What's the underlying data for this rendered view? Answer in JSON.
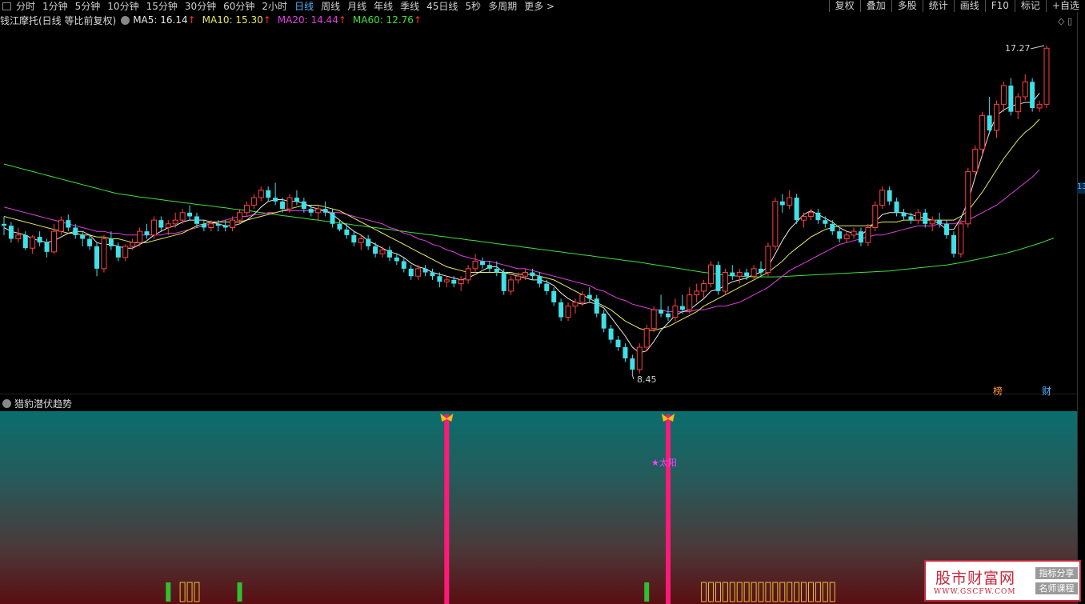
{
  "toolbar": {
    "items": [
      "分时",
      "1分钟",
      "5分钟",
      "10分钟",
      "15分钟",
      "30分钟",
      "60分钟",
      "2小时",
      "日线",
      "周线",
      "月线",
      "年线",
      "季线",
      "45日线",
      "5秒",
      "多周期",
      "更多 >"
    ],
    "active_index": 8,
    "right": [
      "复权",
      "叠加",
      "多股",
      "统计",
      "画线",
      "F10",
      "标记",
      "+自选"
    ]
  },
  "main_header": {
    "title": "钱江摩托(日线 等比前复权)",
    "ma": [
      {
        "label": "MA5: 16.14",
        "color": "#e8e8e8"
      },
      {
        "label": "MA10: 15.30",
        "color": "#e8e860"
      },
      {
        "label": "MA20: 14.44",
        "color": "#e040e0"
      },
      {
        "label": "MA60: 12.76",
        "color": "#40e040"
      }
    ],
    "arrow": "↑"
  },
  "annotations": {
    "high": "17.27",
    "low": "8.45",
    "badge1": "榜",
    "badge2": "财",
    "price_tag": "13"
  },
  "sub_header": {
    "title": "猎豹潜伏趋势"
  },
  "sub": {
    "label_sun": "★太阳"
  },
  "watermark": {
    "big": "股市财富网",
    "url": "WWW.GSCFW.COM",
    "tag1": "指标分享",
    "tag2": "名师课程"
  },
  "colors": {
    "up": "#ff4040",
    "down": "#40e0e8",
    "ma5": "#e8e8e8",
    "ma10": "#e8e860",
    "ma20": "#e040e0",
    "ma60": "#40e040",
    "signal": "#ff1a7a"
  },
  "chart_data": {
    "type": "candlestick",
    "price_range": [
      8.45,
      17.27
    ],
    "candles": [
      [
        12.5,
        12.7,
        12.2,
        12.45
      ],
      [
        12.45,
        12.55,
        12.0,
        12.1
      ],
      [
        12.1,
        12.4,
        12.0,
        12.2
      ],
      [
        12.2,
        12.3,
        11.8,
        11.85
      ],
      [
        11.85,
        12.2,
        11.7,
        12.15
      ],
      [
        12.15,
        12.3,
        11.9,
        12.0
      ],
      [
        12.0,
        12.1,
        11.6,
        11.75
      ],
      [
        11.75,
        12.5,
        11.7,
        12.3
      ],
      [
        12.3,
        12.7,
        12.2,
        12.6
      ],
      [
        12.6,
        12.75,
        12.3,
        12.4
      ],
      [
        12.4,
        12.5,
        12.1,
        12.2
      ],
      [
        12.2,
        12.3,
        11.9,
        12.1
      ],
      [
        12.1,
        12.2,
        11.8,
        11.9
      ],
      [
        11.9,
        12.0,
        11.1,
        11.3
      ],
      [
        11.3,
        12.2,
        11.2,
        12.1
      ],
      [
        12.1,
        12.3,
        11.8,
        11.9
      ],
      [
        11.9,
        12.0,
        11.5,
        11.6
      ],
      [
        11.6,
        11.95,
        11.5,
        11.9
      ],
      [
        11.9,
        12.1,
        11.8,
        12.0
      ],
      [
        12.0,
        12.4,
        11.9,
        12.3
      ],
      [
        12.3,
        12.5,
        12.1,
        12.2
      ],
      [
        12.2,
        12.7,
        12.1,
        12.6
      ],
      [
        12.6,
        12.7,
        12.3,
        12.4
      ],
      [
        12.4,
        12.6,
        12.2,
        12.5
      ],
      [
        12.5,
        12.8,
        12.4,
        12.6
      ],
      [
        12.6,
        12.9,
        12.5,
        12.8
      ],
      [
        12.8,
        13.0,
        12.6,
        12.7
      ],
      [
        12.7,
        12.8,
        12.4,
        12.5
      ],
      [
        12.5,
        12.6,
        12.3,
        12.4
      ],
      [
        12.4,
        12.6,
        12.3,
        12.5
      ],
      [
        12.5,
        12.6,
        12.3,
        12.45
      ],
      [
        12.45,
        12.6,
        12.3,
        12.4
      ],
      [
        12.4,
        12.7,
        12.3,
        12.6
      ],
      [
        12.6,
        12.9,
        12.5,
        12.8
      ],
      [
        12.8,
        13.1,
        12.7,
        13.0
      ],
      [
        13.0,
        13.3,
        12.9,
        13.2
      ],
      [
        13.2,
        13.5,
        13.1,
        13.4
      ],
      [
        13.4,
        13.5,
        13.1,
        13.2
      ],
      [
        13.2,
        13.6,
        13.0,
        13.1
      ],
      [
        13.1,
        13.2,
        12.8,
        12.9
      ],
      [
        12.9,
        13.3,
        12.8,
        13.2
      ],
      [
        13.2,
        13.4,
        13.0,
        13.1
      ],
      [
        13.1,
        13.2,
        12.8,
        12.9
      ],
      [
        12.9,
        13.0,
        12.7,
        12.8
      ],
      [
        12.8,
        13.0,
        12.6,
        12.9
      ],
      [
        12.9,
        13.1,
        12.7,
        12.8
      ],
      [
        12.8,
        12.9,
        12.4,
        12.5
      ],
      [
        12.5,
        12.6,
        12.3,
        12.35
      ],
      [
        12.35,
        12.5,
        12.1,
        12.2
      ],
      [
        12.2,
        12.3,
        11.9,
        12.0
      ],
      [
        12.0,
        12.2,
        11.8,
        12.1
      ],
      [
        12.1,
        12.2,
        11.8,
        11.9
      ],
      [
        11.9,
        12.0,
        11.6,
        11.7
      ],
      [
        11.7,
        11.9,
        11.6,
        11.8
      ],
      [
        11.8,
        11.9,
        11.5,
        11.6
      ],
      [
        11.6,
        11.7,
        11.4,
        11.5
      ],
      [
        11.5,
        11.6,
        11.2,
        11.3
      ],
      [
        11.3,
        11.4,
        11.0,
        11.1
      ],
      [
        11.1,
        11.4,
        11.0,
        11.3
      ],
      [
        11.3,
        11.4,
        11.1,
        11.2
      ],
      [
        11.2,
        11.3,
        11.0,
        11.1
      ],
      [
        11.1,
        11.2,
        10.8,
        10.95
      ],
      [
        10.95,
        11.1,
        10.8,
        11.0
      ],
      [
        11.0,
        11.1,
        10.8,
        10.9
      ],
      [
        10.9,
        11.1,
        10.7,
        11.0
      ],
      [
        11.0,
        11.4,
        10.9,
        11.3
      ],
      [
        11.3,
        11.7,
        11.2,
        11.5
      ],
      [
        11.5,
        11.6,
        11.3,
        11.4
      ],
      [
        11.4,
        11.5,
        11.2,
        11.3
      ],
      [
        11.3,
        11.5,
        11.1,
        11.2
      ],
      [
        11.2,
        11.3,
        10.6,
        10.7
      ],
      [
        10.7,
        11.1,
        10.6,
        11.0
      ],
      [
        11.0,
        11.2,
        10.9,
        11.1
      ],
      [
        11.1,
        11.3,
        11.0,
        11.2
      ],
      [
        11.2,
        11.3,
        11.0,
        11.1
      ],
      [
        11.1,
        11.2,
        10.8,
        10.9
      ],
      [
        10.9,
        11.0,
        10.6,
        10.7
      ],
      [
        10.7,
        10.8,
        10.3,
        10.4
      ],
      [
        10.4,
        10.5,
        9.9,
        10.0
      ],
      [
        10.0,
        10.4,
        9.9,
        10.3
      ],
      [
        10.3,
        10.5,
        10.1,
        10.4
      ],
      [
        10.4,
        10.7,
        10.3,
        10.6
      ],
      [
        10.6,
        10.8,
        10.4,
        10.5
      ],
      [
        10.5,
        10.6,
        10.0,
        10.1
      ],
      [
        10.1,
        10.2,
        9.6,
        9.7
      ],
      [
        9.7,
        9.8,
        9.3,
        9.4
      ],
      [
        9.4,
        9.5,
        9.1,
        9.2
      ],
      [
        9.2,
        9.3,
        8.8,
        8.9
      ],
      [
        8.9,
        9.0,
        8.45,
        8.6
      ],
      [
        8.6,
        9.3,
        8.5,
        9.2
      ],
      [
        9.2,
        9.8,
        9.1,
        9.7
      ],
      [
        9.7,
        10.3,
        9.6,
        10.2
      ],
      [
        10.2,
        10.6,
        10.0,
        10.1
      ],
      [
        10.1,
        10.3,
        9.9,
        10.0
      ],
      [
        10.0,
        10.5,
        9.9,
        10.3
      ],
      [
        10.3,
        10.6,
        10.1,
        10.2
      ],
      [
        10.2,
        10.8,
        10.1,
        10.6
      ],
      [
        10.6,
        10.9,
        10.4,
        10.7
      ],
      [
        10.7,
        11.0,
        10.5,
        10.9
      ],
      [
        10.9,
        11.5,
        10.8,
        11.4
      ],
      [
        11.4,
        11.5,
        10.6,
        10.7
      ],
      [
        10.7,
        11.3,
        10.6,
        11.2
      ],
      [
        11.2,
        11.4,
        11.0,
        11.1
      ],
      [
        11.1,
        11.3,
        10.9,
        11.2
      ],
      [
        11.2,
        11.3,
        11.0,
        11.1
      ],
      [
        11.1,
        11.4,
        11.0,
        11.3
      ],
      [
        11.3,
        11.5,
        11.1,
        11.2
      ],
      [
        11.2,
        12.0,
        11.1,
        11.9
      ],
      [
        11.9,
        13.2,
        11.8,
        13.1
      ],
      [
        13.1,
        13.3,
        12.8,
        13.0
      ],
      [
        13.0,
        13.4,
        12.9,
        13.2
      ],
      [
        13.2,
        13.3,
        12.5,
        12.6
      ],
      [
        12.6,
        12.8,
        12.4,
        12.7
      ],
      [
        12.7,
        12.9,
        12.6,
        12.8
      ],
      [
        12.8,
        12.9,
        12.5,
        12.6
      ],
      [
        12.6,
        12.7,
        12.4,
        12.5
      ],
      [
        12.5,
        12.6,
        12.2,
        12.3
      ],
      [
        12.3,
        12.4,
        12.0,
        12.1
      ],
      [
        12.1,
        12.3,
        12.0,
        12.2
      ],
      [
        12.2,
        12.4,
        12.1,
        12.3
      ],
      [
        12.3,
        12.4,
        11.9,
        12.0
      ],
      [
        12.0,
        12.5,
        11.9,
        12.4
      ],
      [
        12.4,
        13.1,
        12.3,
        13.0
      ],
      [
        13.0,
        13.5,
        12.9,
        13.4
      ],
      [
        13.4,
        13.5,
        13.0,
        13.1
      ],
      [
        13.1,
        13.2,
        12.7,
        12.8
      ],
      [
        12.8,
        12.9,
        12.6,
        12.7
      ],
      [
        12.7,
        12.8,
        12.5,
        12.6
      ],
      [
        12.6,
        12.9,
        12.5,
        12.8
      ],
      [
        12.8,
        12.9,
        12.4,
        12.5
      ],
      [
        12.5,
        12.7,
        12.3,
        12.6
      ],
      [
        12.6,
        12.8,
        12.4,
        12.5
      ],
      [
        12.5,
        12.6,
        12.1,
        12.2
      ],
      [
        12.2,
        12.3,
        11.6,
        11.7
      ],
      [
        11.7,
        12.6,
        11.6,
        12.5
      ],
      [
        12.5,
        14.0,
        12.4,
        13.9
      ],
      [
        13.9,
        14.6,
        13.8,
        14.5
      ],
      [
        14.5,
        15.5,
        14.3,
        15.4
      ],
      [
        15.4,
        15.9,
        14.9,
        15.0
      ],
      [
        15.0,
        15.8,
        14.8,
        15.7
      ],
      [
        15.7,
        16.3,
        15.5,
        16.2
      ],
      [
        16.2,
        16.4,
        15.4,
        15.5
      ],
      [
        15.5,
        16.0,
        15.3,
        15.9
      ],
      [
        15.9,
        16.5,
        15.8,
        16.3
      ],
      [
        16.3,
        16.4,
        15.5,
        15.6
      ],
      [
        15.6,
        15.8,
        15.5,
        15.7
      ],
      [
        15.7,
        17.27,
        15.6,
        17.2
      ]
    ],
    "ma5": [
      12.4,
      12.3,
      12.25,
      12.2,
      12.1,
      12.05,
      12.0,
      12.05,
      12.15,
      12.25,
      12.3,
      12.3,
      12.2,
      12.0,
      11.95,
      11.95,
      11.9,
      11.85,
      11.85,
      11.95,
      12.05,
      12.2,
      12.3,
      12.4,
      12.45,
      12.55,
      12.6,
      12.6,
      12.6,
      12.55,
      12.5,
      12.45,
      12.45,
      12.5,
      12.6,
      12.75,
      12.95,
      13.1,
      13.15,
      13.15,
      13.1,
      13.1,
      13.05,
      12.95,
      12.9,
      12.85,
      12.75,
      12.6,
      12.45,
      12.3,
      12.2,
      12.05,
      11.95,
      11.85,
      11.75,
      11.7,
      11.6,
      11.45,
      11.35,
      11.3,
      11.2,
      11.15,
      11.1,
      11.05,
      11.0,
      11.05,
      11.15,
      11.25,
      11.35,
      11.35,
      11.2,
      11.15,
      11.1,
      11.05,
      11.0,
      11.0,
      10.95,
      10.85,
      10.65,
      10.5,
      10.4,
      10.35,
      10.4,
      10.35,
      10.25,
      10.0,
      9.75,
      9.5,
      9.2,
      9.05,
      9.1,
      9.35,
      9.65,
      9.85,
      10.05,
      10.15,
      10.2,
      10.35,
      10.5,
      10.7,
      10.75,
      10.85,
      10.95,
      11.0,
      11.05,
      11.15,
      11.2,
      11.35,
      11.7,
      12.05,
      12.35,
      12.55,
      12.75,
      12.85,
      12.75,
      12.65,
      12.55,
      12.4,
      12.3,
      12.25,
      12.2,
      12.35,
      12.55,
      12.75,
      12.8,
      12.8,
      12.8,
      12.75,
      12.7,
      12.65,
      12.6,
      12.5,
      12.35,
      12.35,
      12.65,
      13.1,
      13.75,
      14.35,
      14.95,
      15.4,
      15.55,
      15.65,
      15.7,
      15.75,
      15.75,
      16.0
    ],
    "ma10": [
      12.7,
      12.65,
      12.6,
      12.55,
      12.5,
      12.45,
      12.4,
      12.35,
      12.3,
      12.25,
      12.25,
      12.2,
      12.2,
      12.15,
      12.15,
      12.1,
      12.1,
      12.05,
      12.0,
      12.0,
      12.0,
      12.05,
      12.1,
      12.15,
      12.2,
      12.25,
      12.35,
      12.45,
      12.5,
      12.55,
      12.55,
      12.55,
      12.55,
      12.55,
      12.6,
      12.65,
      12.7,
      12.75,
      12.8,
      12.85,
      12.9,
      12.95,
      13.0,
      13.0,
      13.0,
      12.95,
      12.9,
      12.85,
      12.75,
      12.65,
      12.55,
      12.45,
      12.35,
      12.25,
      12.15,
      12.05,
      11.95,
      11.85,
      11.75,
      11.65,
      11.55,
      11.45,
      11.35,
      11.3,
      11.25,
      11.2,
      11.2,
      11.2,
      11.2,
      11.2,
      11.2,
      11.2,
      11.15,
      11.15,
      11.15,
      11.1,
      11.05,
      11.0,
      10.9,
      10.8,
      10.7,
      10.6,
      10.5,
      10.4,
      10.3,
      10.2,
      10.05,
      9.9,
      9.8,
      9.7,
      9.65,
      9.65,
      9.7,
      9.75,
      9.85,
      9.95,
      10.05,
      10.15,
      10.3,
      10.4,
      10.5,
      10.6,
      10.7,
      10.8,
      10.9,
      11.0,
      11.1,
      11.2,
      11.35,
      11.5,
      11.7,
      11.85,
      12.0,
      12.15,
      12.25,
      12.35,
      12.4,
      12.45,
      12.45,
      12.45,
      12.45,
      12.45,
      12.5,
      12.55,
      12.55,
      12.55,
      12.6,
      12.6,
      12.6,
      12.6,
      12.6,
      12.6,
      12.6,
      12.6,
      12.7,
      12.85,
      13.1,
      13.35,
      13.65,
      13.95,
      14.25,
      14.5,
      14.75,
      14.95,
      15.1,
      15.3
    ],
    "ma20": [
      12.95,
      12.9,
      12.85,
      12.8,
      12.75,
      12.7,
      12.65,
      12.6,
      12.55,
      12.5,
      12.45,
      12.4,
      12.35,
      12.3,
      12.3,
      12.25,
      12.25,
      12.2,
      12.2,
      12.2,
      12.2,
      12.2,
      12.2,
      12.25,
      12.25,
      12.3,
      12.35,
      12.4,
      12.45,
      12.5,
      12.55,
      12.6,
      12.65,
      12.7,
      12.7,
      12.75,
      12.75,
      12.8,
      12.8,
      12.85,
      12.85,
      12.85,
      12.85,
      12.85,
      12.85,
      12.85,
      12.8,
      12.8,
      12.75,
      12.7,
      12.65,
      12.6,
      12.55,
      12.5,
      12.4,
      12.35,
      12.25,
      12.2,
      12.1,
      12.05,
      11.95,
      11.9,
      11.8,
      11.75,
      11.65,
      11.6,
      11.55,
      11.5,
      11.5,
      11.45,
      11.4,
      11.35,
      11.3,
      11.3,
      11.25,
      11.2,
      11.15,
      11.1,
      11.05,
      11.0,
      10.95,
      10.9,
      10.85,
      10.75,
      10.7,
      10.6,
      10.5,
      10.45,
      10.35,
      10.3,
      10.25,
      10.2,
      10.2,
      10.15,
      10.15,
      10.15,
      10.15,
      10.2,
      10.2,
      10.25,
      10.3,
      10.3,
      10.35,
      10.4,
      10.5,
      10.6,
      10.7,
      10.8,
      10.95,
      11.1,
      11.25,
      11.35,
      11.45,
      11.55,
      11.65,
      11.75,
      11.85,
      11.95,
      12.0,
      12.05,
      12.1,
      12.15,
      12.2,
      12.2,
      12.25,
      12.3,
      12.35,
      12.4,
      12.45,
      12.45,
      12.45,
      12.5,
      12.5,
      12.5,
      12.55,
      12.6,
      12.7,
      12.8,
      12.9,
      13.0,
      13.15,
      13.3,
      13.45,
      13.6,
      13.75,
      13.95
    ],
    "ma60": [
      14.1,
      14.05,
      14.0,
      13.95,
      13.9,
      13.85,
      13.8,
      13.75,
      13.7,
      13.65,
      13.6,
      13.55,
      13.5,
      13.45,
      13.4,
      13.35,
      13.3,
      13.28,
      13.25,
      13.22,
      13.2,
      13.17,
      13.15,
      13.12,
      13.1,
      13.07,
      13.05,
      13.02,
      13.0,
      12.98,
      12.95,
      12.93,
      12.9,
      12.88,
      12.86,
      12.83,
      12.8,
      12.78,
      12.75,
      12.72,
      12.7,
      12.67,
      12.65,
      12.62,
      12.6,
      12.57,
      12.55,
      12.52,
      12.5,
      12.47,
      12.45,
      12.42,
      12.4,
      12.37,
      12.35,
      12.32,
      12.3,
      12.27,
      12.25,
      12.22,
      12.2,
      12.17,
      12.15,
      12.12,
      12.1,
      12.07,
      12.05,
      12.02,
      12.0,
      11.97,
      11.95,
      11.92,
      11.9,
      11.87,
      11.85,
      11.82,
      11.8,
      11.77,
      11.75,
      11.72,
      11.7,
      11.67,
      11.65,
      11.62,
      11.6,
      11.57,
      11.55,
      11.52,
      11.5,
      11.47,
      11.44,
      11.41,
      11.38,
      11.35,
      11.32,
      11.29,
      11.26,
      11.23,
      11.2,
      11.18,
      11.15,
      11.13,
      11.11,
      11.1,
      11.09,
      11.08,
      11.08,
      11.08,
      11.08,
      11.09,
      11.1,
      11.11,
      11.12,
      11.13,
      11.14,
      11.15,
      11.16,
      11.17,
      11.18,
      11.19,
      11.2,
      11.21,
      11.22,
      11.23,
      11.24,
      11.26,
      11.28,
      11.3,
      11.32,
      11.34,
      11.36,
      11.38,
      11.4,
      11.43,
      11.46,
      11.5,
      11.54,
      11.58,
      11.62,
      11.66,
      11.7,
      11.75,
      11.8,
      11.86,
      11.92,
      11.98,
      12.05,
      12.12
    ],
    "sub_signals": {
      "pink_bars": [
        62,
        93
      ],
      "green_bars": [
        23,
        33,
        90
      ],
      "yellow_boxes": [
        [
          25,
          27
        ],
        [
          98,
          116
        ]
      ]
    }
  }
}
